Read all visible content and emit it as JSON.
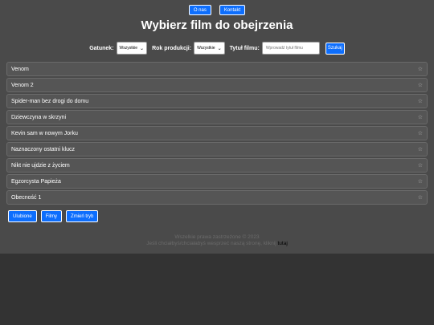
{
  "nav": {
    "about": "O nas",
    "contact": "Kontakt"
  },
  "title": "Wybierz film do obejrzenia",
  "filters": {
    "genre_label": "Gatunek:",
    "genre_value": "Wszystkie",
    "year_label": "Rok produkcji:",
    "year_value": "Wszystkie",
    "title_label": "Tytuł filmu:",
    "title_placeholder": "Wprowadź tytuł filmu",
    "search_label": "Szukaj"
  },
  "movies": [
    "Venom",
    "Venom 2",
    "Spider-man bez drogi do domu",
    "Dziewczyna w skrzyni",
    "Kevin sam w nowym Jorku",
    "Naznaczony ostatni klucz",
    "Nikt nie ujdzie z życiem",
    "Egzorcysta Papieża",
    "Obecność 1"
  ],
  "star_icon": "star-icon",
  "bottom_buttons": {
    "favorites": "Ulubione",
    "films": "Filmy",
    "mode": "Zmień tryb"
  },
  "footer": {
    "copyright": "Wszelkie prawa zastrzeżone © 2023",
    "support_text": "Jeśli chciałbyś/chciałabyś wesprzeć naszą stronę, kliknij",
    "support_link": "tutaj"
  },
  "colors": {
    "accent": "#0d6efd",
    "page_bg": "#4a4a4a",
    "body_bg": "#333333",
    "item_bg": "#555555"
  }
}
